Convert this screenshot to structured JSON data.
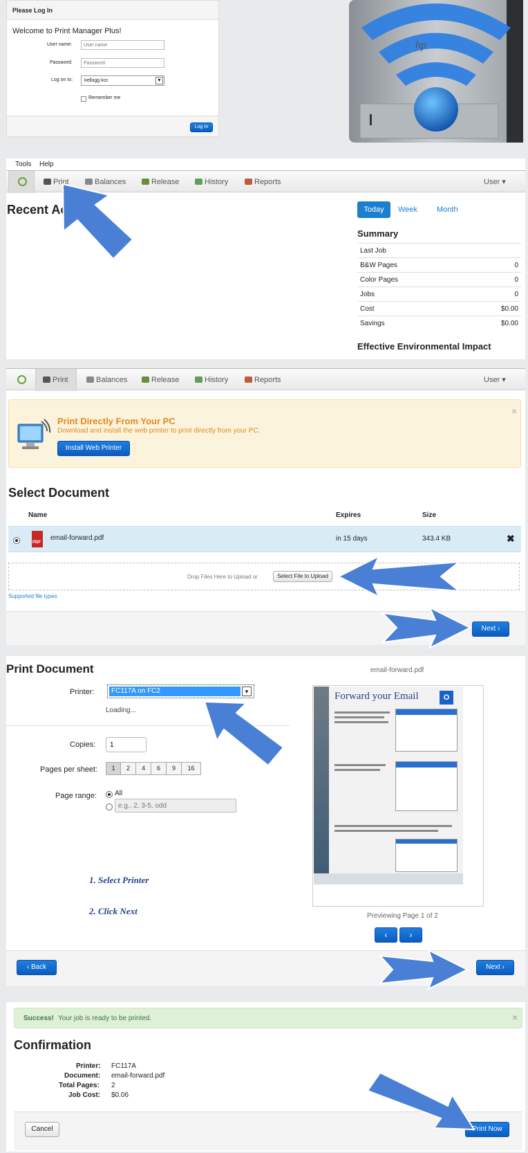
{
  "login": {
    "header": "Please Log In",
    "welcome": "Welcome to Print Manager Plus!",
    "username_label": "User name:",
    "username_placeholder": "User name",
    "password_label": "Password:",
    "password_placeholder": "Password",
    "logon_label": "Log on to:",
    "logon_value": "kellogg kcc",
    "remember_label": "Remember me",
    "login_button": "Log In"
  },
  "printer_image": {
    "brand": "hp"
  },
  "menubar": {
    "tools": "Tools",
    "help": "Help"
  },
  "nav": {
    "print": "Print",
    "balances": "Balances",
    "release": "Release",
    "history": "History",
    "reports": "Reports",
    "user": "User ▾"
  },
  "dashboard": {
    "recent_title": "Recent Ac",
    "tabs": [
      "Today",
      "Week",
      "Month"
    ],
    "summary_title": "Summary",
    "summary_rows": [
      {
        "label": "Last Job",
        "value": ""
      },
      {
        "label": "B&W Pages",
        "value": "0"
      },
      {
        "label": "Color Pages",
        "value": "0"
      },
      {
        "label": "Jobs",
        "value": "0"
      },
      {
        "label": "Cost",
        "value": "$0.00"
      },
      {
        "label": "Savings",
        "value": "$0.00"
      }
    ],
    "env_title": "Effective Environmental Impact"
  },
  "upload": {
    "banner_title": "Print Directly From Your PC",
    "banner_text": "Download and install the web printer to print directly from your PC.",
    "install_button": "Install Web Printer",
    "close": "×",
    "section_title": "Select Document",
    "columns": {
      "name": "Name",
      "expires": "Expires",
      "size": "Size"
    },
    "file": {
      "name": "email-forward.pdf",
      "expires": "in 15 days",
      "size": "343.4 KB",
      "badge": "PDF"
    },
    "drop_text": "Drop Files Here to Upload or",
    "select_button": "Select File to Upload",
    "supported": "Supported file types",
    "next_button": "Next"
  },
  "print_doc": {
    "title": "Print Document",
    "printer_label": "Printer:",
    "printer_value": "FC117A on FC2",
    "loading": "Loading...",
    "copies_label": "Copies:",
    "copies_value": "1",
    "pps_label": "Pages per sheet:",
    "pps_options": [
      "1",
      "2",
      "4",
      "6",
      "9",
      "16"
    ],
    "range_label": "Page range:",
    "range_all": "All",
    "range_placeholder": "e.g., 2, 3-5, odd",
    "step1": "1. Select Printer",
    "step2": "2. Click Next",
    "preview_filename": "email-forward.pdf",
    "preview_heading": "Forward your Email",
    "preview_footer": "Previewing Page 1 of 2",
    "back_button": "Back",
    "next_button": "Next"
  },
  "confirm": {
    "success_bold": "Success!",
    "success_text": "Your job is ready to be printed.",
    "title": "Confirmation",
    "rows": [
      {
        "label": "Printer:",
        "value": "FC117A"
      },
      {
        "label": "Document:",
        "value": "email-forward.pdf"
      },
      {
        "label": "Total Pages:",
        "value": "2"
      },
      {
        "label": "Job Cost:",
        "value": "$0.06"
      }
    ],
    "cancel_button": "Cancel",
    "print_button": "Print Now"
  },
  "colors": {
    "accent_blue": "#0a5cc0",
    "arrow_blue": "#4a7fd6",
    "banner_bg": "#fcf3dc",
    "banner_title": "#e08a1e",
    "success_bg": "#dff0d8",
    "success_text": "#3c763d",
    "selected_row": "#d9ecf6"
  }
}
